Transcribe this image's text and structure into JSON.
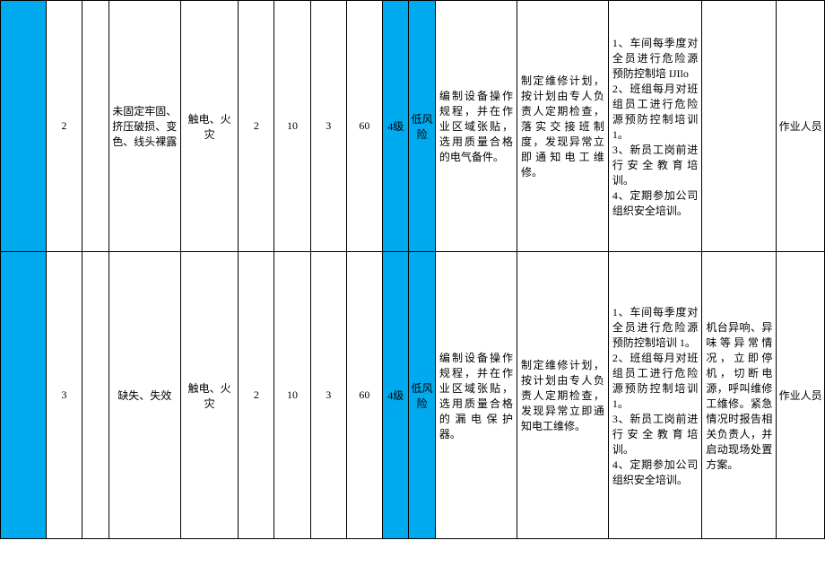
{
  "rows": [
    {
      "col1": "",
      "seq": "2",
      "col3": "",
      "defect": "未固定牢固、挤压破损、变色、线头裸露",
      "hazard": "触电、火灾",
      "l": "2",
      "e": "10",
      "c": "3",
      "d": "60",
      "level_num": "4级",
      "level_text": "低风险",
      "measure1": "编制设备操作规程，并在作业区域张贴，选用质量合格的电气备件。",
      "measure2": "制定维修计划，按计划由专人负责人定期检查，落实交接班制度，发现异常立即通知电工维修。",
      "training": "1、车间每季度对全员进行危险源预防控制培 IJIlo\n2、班组每月对班组员工进行危险源预防控制培训 1。\n3、新员工岗前进行安全教育培训。\n4、定期参加公司组织安全培训。",
      "emergency": "",
      "responsible": "作业人员"
    },
    {
      "col1": "",
      "seq": "3",
      "col3": "",
      "defect": "缺失、失效",
      "hazard": "触电、火灾",
      "l": "2",
      "e": "10",
      "c": "3",
      "d": "60",
      "level_num": "4级",
      "level_text": "低风险",
      "measure1": "编制设备操作规程，并在作业区域张贴，选用质量合格的漏电保护器。",
      "measure2": "制定维修计划，按计划由专人负责人定期检查，发现异常立即通知电工维修。",
      "training": "1、车间每季度对全员进行危险源预防控制培训 1。\n2、班组每月对班组员工进行危险源预防控制培训 1。\n3、新员工岗前进行安全教育培训。\n4、定期参加公司组织安全培训。",
      "emergency": "机台异响、异味等异常情况，立即停机，切断电源，呼叫维修工维修。紧急情况时报告相关负责人，并启动现场处置方案。",
      "responsible": "作业人员"
    }
  ]
}
